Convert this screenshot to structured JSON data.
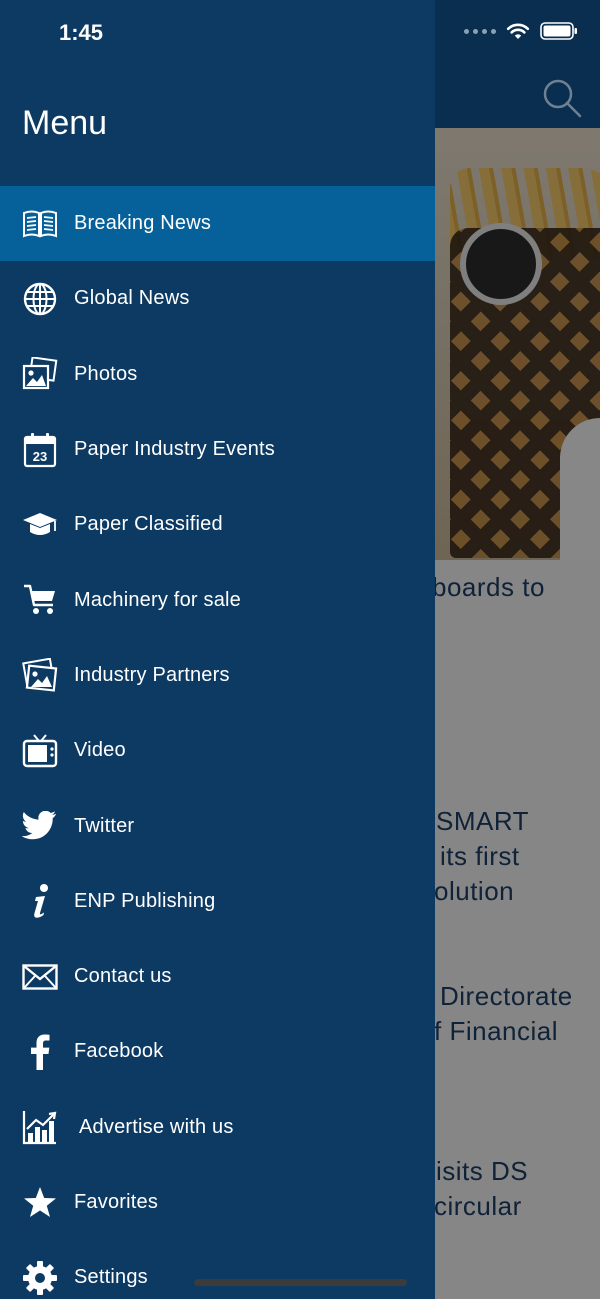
{
  "status_bar": {
    "time": "1:45"
  },
  "menu": {
    "title": "Menu",
    "items": [
      {
        "label": "Breaking News",
        "icon": "newspaper-icon",
        "active": true
      },
      {
        "label": "Global News",
        "icon": "globe-icon"
      },
      {
        "label": "Photos",
        "icon": "photos-icon"
      },
      {
        "label": "Paper Industry Events",
        "icon": "calendar-icon",
        "icon_text": "23"
      },
      {
        "label": "Paper Classified",
        "icon": "graduation-cap-icon"
      },
      {
        "label": "Machinery for sale",
        "icon": "cart-icon"
      },
      {
        "label": "Industry Partners",
        "icon": "partners-photo-icon"
      },
      {
        "label": "Video",
        "icon": "tv-icon"
      },
      {
        "label": "Twitter",
        "icon": "twitter-bird-icon"
      },
      {
        "label": "ENP Publishing",
        "icon": "info-icon"
      },
      {
        "label": "Contact us",
        "icon": "envelope-icon"
      },
      {
        "label": "Facebook",
        "icon": "facebook-icon"
      },
      {
        "label": "Advertise with us",
        "icon": "chart-icon"
      },
      {
        "label": "Favorites",
        "icon": "star-icon"
      },
      {
        "label": "Settings",
        "icon": "gear-icon"
      }
    ]
  },
  "background": {
    "headline_fragments": [
      "boards to",
      "SMART",
      "its first",
      "olution",
      "Directorate",
      "f Financial",
      "isits DS",
      "circular"
    ]
  },
  "colors": {
    "drawer": "#0d3a63",
    "active_item": "#06619a",
    "text": "#ffffff"
  }
}
